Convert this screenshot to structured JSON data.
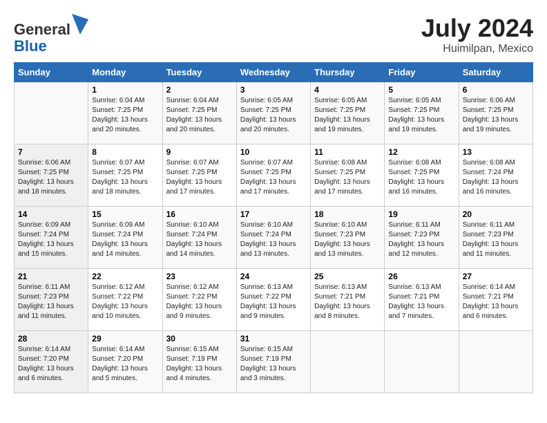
{
  "header": {
    "logo_general": "General",
    "logo_blue": "Blue",
    "month_title": "July 2024",
    "location": "Huimilpan, Mexico"
  },
  "weekdays": [
    "Sunday",
    "Monday",
    "Tuesday",
    "Wednesday",
    "Thursday",
    "Friday",
    "Saturday"
  ],
  "weeks": [
    [
      {
        "day": "",
        "info": ""
      },
      {
        "day": "1",
        "info": "Sunrise: 6:04 AM\nSunset: 7:25 PM\nDaylight: 13 hours\nand 20 minutes."
      },
      {
        "day": "2",
        "info": "Sunrise: 6:04 AM\nSunset: 7:25 PM\nDaylight: 13 hours\nand 20 minutes."
      },
      {
        "day": "3",
        "info": "Sunrise: 6:05 AM\nSunset: 7:25 PM\nDaylight: 13 hours\nand 20 minutes."
      },
      {
        "day": "4",
        "info": "Sunrise: 6:05 AM\nSunset: 7:25 PM\nDaylight: 13 hours\nand 19 minutes."
      },
      {
        "day": "5",
        "info": "Sunrise: 6:05 AM\nSunset: 7:25 PM\nDaylight: 13 hours\nand 19 minutes."
      },
      {
        "day": "6",
        "info": "Sunrise: 6:06 AM\nSunset: 7:25 PM\nDaylight: 13 hours\nand 19 minutes."
      }
    ],
    [
      {
        "day": "7",
        "info": "Sunrise: 6:06 AM\nSunset: 7:25 PM\nDaylight: 13 hours\nand 18 minutes."
      },
      {
        "day": "8",
        "info": "Sunrise: 6:07 AM\nSunset: 7:25 PM\nDaylight: 13 hours\nand 18 minutes."
      },
      {
        "day": "9",
        "info": "Sunrise: 6:07 AM\nSunset: 7:25 PM\nDaylight: 13 hours\nand 17 minutes."
      },
      {
        "day": "10",
        "info": "Sunrise: 6:07 AM\nSunset: 7:25 PM\nDaylight: 13 hours\nand 17 minutes."
      },
      {
        "day": "11",
        "info": "Sunrise: 6:08 AM\nSunset: 7:25 PM\nDaylight: 13 hours\nand 17 minutes."
      },
      {
        "day": "12",
        "info": "Sunrise: 6:08 AM\nSunset: 7:25 PM\nDaylight: 13 hours\nand 16 minutes."
      },
      {
        "day": "13",
        "info": "Sunrise: 6:08 AM\nSunset: 7:24 PM\nDaylight: 13 hours\nand 16 minutes."
      }
    ],
    [
      {
        "day": "14",
        "info": "Sunrise: 6:09 AM\nSunset: 7:24 PM\nDaylight: 13 hours\nand 15 minutes."
      },
      {
        "day": "15",
        "info": "Sunrise: 6:09 AM\nSunset: 7:24 PM\nDaylight: 13 hours\nand 14 minutes."
      },
      {
        "day": "16",
        "info": "Sunrise: 6:10 AM\nSunset: 7:24 PM\nDaylight: 13 hours\nand 14 minutes."
      },
      {
        "day": "17",
        "info": "Sunrise: 6:10 AM\nSunset: 7:24 PM\nDaylight: 13 hours\nand 13 minutes."
      },
      {
        "day": "18",
        "info": "Sunrise: 6:10 AM\nSunset: 7:23 PM\nDaylight: 13 hours\nand 13 minutes."
      },
      {
        "day": "19",
        "info": "Sunrise: 6:11 AM\nSunset: 7:23 PM\nDaylight: 13 hours\nand 12 minutes."
      },
      {
        "day": "20",
        "info": "Sunrise: 6:11 AM\nSunset: 7:23 PM\nDaylight: 13 hours\nand 11 minutes."
      }
    ],
    [
      {
        "day": "21",
        "info": "Sunrise: 6:11 AM\nSunset: 7:23 PM\nDaylight: 13 hours\nand 11 minutes."
      },
      {
        "day": "22",
        "info": "Sunrise: 6:12 AM\nSunset: 7:22 PM\nDaylight: 13 hours\nand 10 minutes."
      },
      {
        "day": "23",
        "info": "Sunrise: 6:12 AM\nSunset: 7:22 PM\nDaylight: 13 hours\nand 9 minutes."
      },
      {
        "day": "24",
        "info": "Sunrise: 6:13 AM\nSunset: 7:22 PM\nDaylight: 13 hours\nand 9 minutes."
      },
      {
        "day": "25",
        "info": "Sunrise: 6:13 AM\nSunset: 7:21 PM\nDaylight: 13 hours\nand 8 minutes."
      },
      {
        "day": "26",
        "info": "Sunrise: 6:13 AM\nSunset: 7:21 PM\nDaylight: 13 hours\nand 7 minutes."
      },
      {
        "day": "27",
        "info": "Sunrise: 6:14 AM\nSunset: 7:21 PM\nDaylight: 13 hours\nand 6 minutes."
      }
    ],
    [
      {
        "day": "28",
        "info": "Sunrise: 6:14 AM\nSunset: 7:20 PM\nDaylight: 13 hours\nand 6 minutes."
      },
      {
        "day": "29",
        "info": "Sunrise: 6:14 AM\nSunset: 7:20 PM\nDaylight: 13 hours\nand 5 minutes."
      },
      {
        "day": "30",
        "info": "Sunrise: 6:15 AM\nSunset: 7:19 PM\nDaylight: 13 hours\nand 4 minutes."
      },
      {
        "day": "31",
        "info": "Sunrise: 6:15 AM\nSunset: 7:19 PM\nDaylight: 13 hours\nand 3 minutes."
      },
      {
        "day": "",
        "info": ""
      },
      {
        "day": "",
        "info": ""
      },
      {
        "day": "",
        "info": ""
      }
    ]
  ]
}
